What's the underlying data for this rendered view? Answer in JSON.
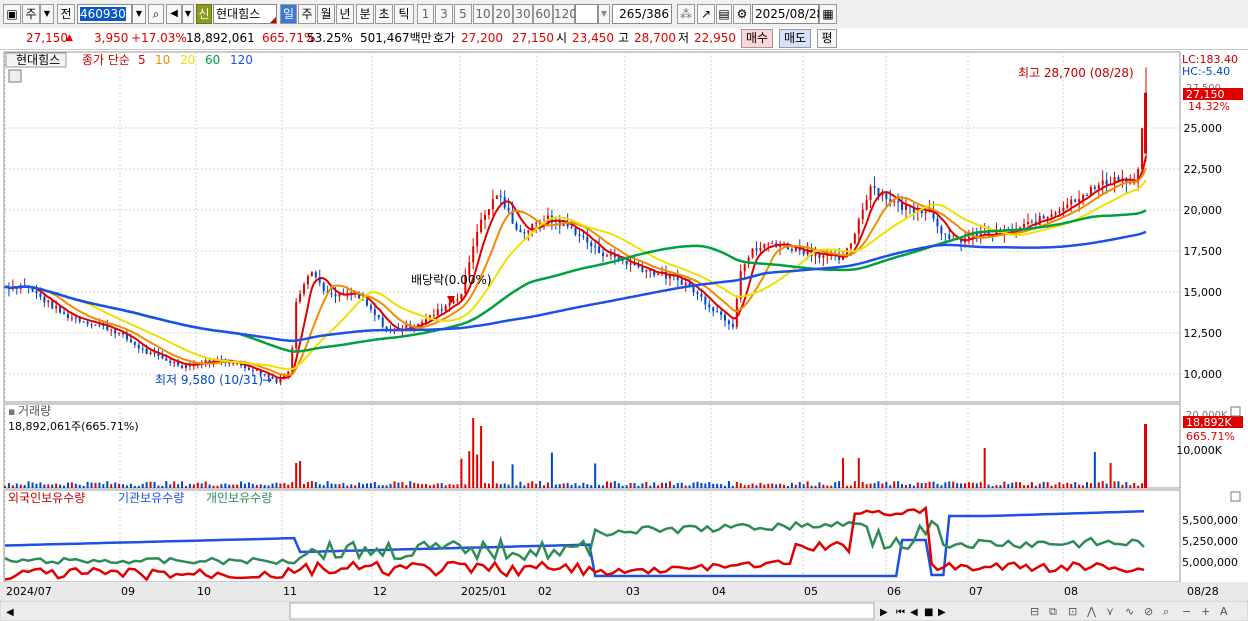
{
  "toolbar": {
    "market": "주",
    "prev_label": "전",
    "code": "460930",
    "tag": "신",
    "stock_name": "현대힘스",
    "periods": [
      "일",
      "주",
      "월",
      "년",
      "분",
      "초",
      "틱"
    ],
    "intervals": [
      "1",
      "3",
      "5",
      "10",
      "20",
      "30",
      "60",
      "120"
    ],
    "count_current": "265",
    "count_total": "/386",
    "date": "2025/08/28"
  },
  "quote": {
    "price": "27,150",
    "change": "3,950",
    "pct": "+17.03%",
    "volume": "18,892,061",
    "vol_ratio": "665.71%",
    "turnover": "53.25%",
    "amount": "501,467백만",
    "bid_label": "호가",
    "bid1": "27,200",
    "bid2": "27,150",
    "open_label": "시",
    "open": "23,450",
    "high_label": "고",
    "high": "28,700",
    "low_label": "저",
    "low": "22,950",
    "buy_label": "매수",
    "sell_label": "매도",
    "eval_label": "평"
  },
  "price_panel": {
    "name": "현대힘스",
    "legend_prefix": "종가 단순",
    "ma": [
      {
        "period": "5",
        "color": "#e00000"
      },
      {
        "period": "10",
        "color": "#f08c00"
      },
      {
        "period": "20",
        "color": "#f0e000"
      },
      {
        "period": "60",
        "color": "#00a040"
      },
      {
        "period": "120",
        "color": "#1e50e6"
      }
    ],
    "lc": "LC:183.40",
    "hc": "HC:-5.40",
    "last_tag": "27,150",
    "pct_tag": "14.32%",
    "prev_high_tick": "27,500",
    "high_annot": "최고 28,700 (08/28)",
    "low_annot": "최저 9,580 (10/31)",
    "dividend_annot": "배당락(0.00%)",
    "y_ticks": [
      "25,000",
      "22,500",
      "20,000",
      "17,500",
      "15,000",
      "12,500",
      "10,000"
    ]
  },
  "volume_panel": {
    "title": "거래량",
    "value_text": "18,892,061주(665.71%)",
    "tag": "18,892K",
    "pct_tag": "665.71%",
    "prev_tick": "20,000K",
    "y_ticks": [
      "10,000K"
    ]
  },
  "holdings_panel": {
    "foreign": "외국인보유수량",
    "inst": "기관보유수량",
    "indiv": "개인보유수량",
    "y_ticks": [
      "5,500,000",
      "5,250,000",
      "5,000,000"
    ]
  },
  "x_axis": {
    "labels": [
      "2024/07",
      "09",
      "10",
      "11",
      "12",
      "2025/01",
      "02",
      "03",
      "04",
      "05",
      "06",
      "07",
      "08",
      "08/28"
    ]
  },
  "colors": {
    "up": "#e00000",
    "down": "#0046c8",
    "ma5": "#e00000",
    "ma10": "#f08c00",
    "ma20": "#f0e000",
    "ma60": "#00a040",
    "ma120": "#1e50e6",
    "foreign": "#e00000",
    "inst": "#1e50e6",
    "indiv": "#2e8b57"
  },
  "chart_data": {
    "type": "candlestick",
    "title": "현대힘스",
    "price_range": [
      8500,
      28700
    ],
    "close_monthly": [
      {
        "month": "2024/07",
        "close": 15200
      },
      {
        "month": "2024/08",
        "close": 12800
      },
      {
        "month": "2024/09",
        "close": 10500
      },
      {
        "month": "2024/10",
        "close": 9800
      },
      {
        "month": "2024/11",
        "close": 14600
      },
      {
        "month": "2024/12",
        "close": 12800
      },
      {
        "month": "2025/01",
        "close": 19500
      },
      {
        "month": "2025/02",
        "close": 17900
      },
      {
        "month": "2025/03",
        "close": 15500
      },
      {
        "month": "2025/04",
        "close": 17800
      },
      {
        "month": "2025/05",
        "close": 16700
      },
      {
        "month": "2025/06",
        "close": 19800
      },
      {
        "month": "2025/07",
        "close": 18700
      },
      {
        "month": "2025/08",
        "close": 27150
      }
    ],
    "high": {
      "value": 28700,
      "date": "08/28"
    },
    "low": {
      "value": 9580,
      "date": "10/31"
    },
    "series": [
      {
        "name": "5"
      },
      {
        "name": "10"
      },
      {
        "name": "20"
      },
      {
        "name": "60"
      },
      {
        "name": "120"
      }
    ]
  }
}
